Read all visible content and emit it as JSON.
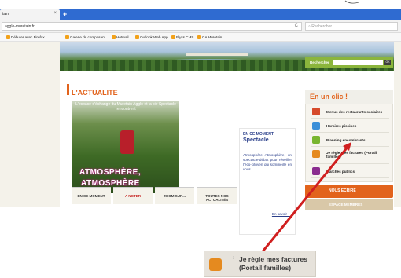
{
  "browser": {
    "tab_title": "tain",
    "tab_close": "×",
    "new_tab": "+",
    "url": "agglo-muretain.fr",
    "reload_icon": "C",
    "search_placeholder": "Rechercher",
    "bookmarks": [
      "Débuter avec Firefox",
      "Galerie de composant...",
      "Hotmail",
      "Outlook Web App",
      "Blyss CMS",
      "CA Muretain"
    ]
  },
  "header": {
    "search_label": "Rechercher",
    "ok_label": "OK"
  },
  "actualite": {
    "title": "L'ACTUALITE",
    "photo_caption": "L'espace d'échange du Muretain Agglo et la cie Spectacle rencontrent",
    "poster_line1": "ATMOSPHÈRE,",
    "poster_line2": "ATMOSPHÈRE",
    "tabs": [
      "EN CE MOMENT",
      "A NOTER",
      "ZOOM SUR...",
      "TOUTES NOS ACTUALITÉS"
    ]
  },
  "moment": {
    "heading": "EN CE MOMENT",
    "subtitle": "Spectacle",
    "text": "Atmosphère Atmosphère, un spectacle-débat pour réveiller l'éco-citoyen qui sommeille en vous !",
    "link": "En savoir +"
  },
  "sidebar": {
    "title": "En un clic !",
    "items": [
      {
        "label": "Menus des restaurants scolaires",
        "icon": "menu-icon",
        "color": "#d64a2b"
      },
      {
        "label": "Horaires piscines",
        "icon": "pool-icon",
        "color": "#3b8fd8"
      },
      {
        "label": "Planning encombrants",
        "icon": "truck-icon",
        "color": "#78b52f"
      },
      {
        "label": "Je règle mes factures (Portail familles)",
        "icon": "invoice-icon",
        "color": "#e58a1f"
      },
      {
        "label": "Marchés publics",
        "icon": "market-icon",
        "color": "#8a2c8f"
      }
    ],
    "write_label": "NOUS ECRIRE",
    "members_label": "ESPACE MEMBRES"
  },
  "zoom": {
    "line1": "Je règle mes factures",
    "line2": "(Portail familles)"
  },
  "colors": {
    "accent": "#e2631c",
    "arrow": "#d01f1f",
    "navy": "#2a3f8a"
  }
}
